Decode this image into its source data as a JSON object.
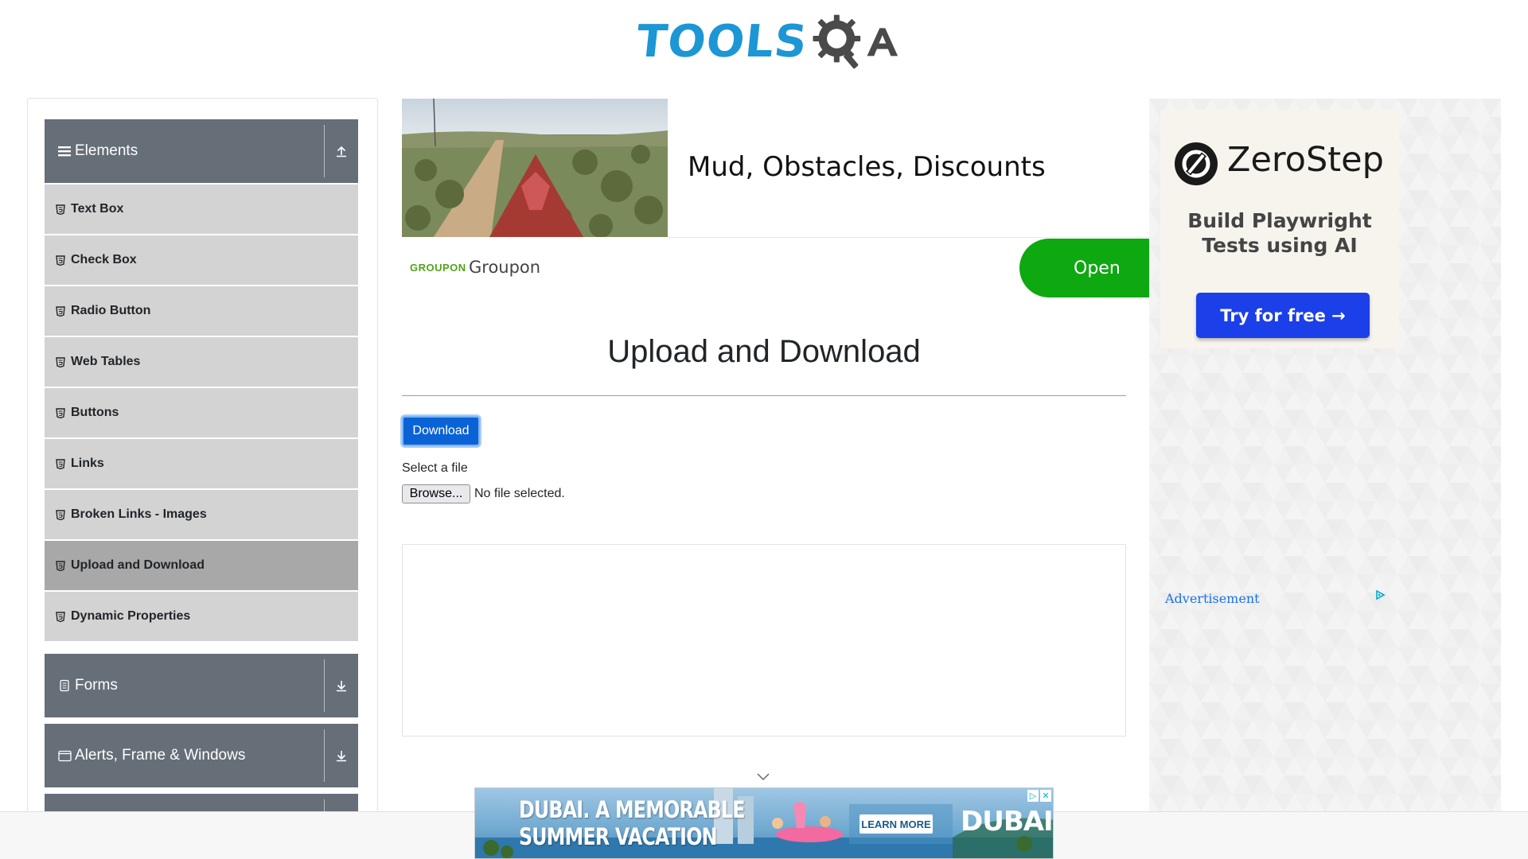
{
  "logo": {
    "text": "TOOLS",
    "suffix": "QA"
  },
  "sidebar": {
    "groups": [
      {
        "label": "Elements",
        "icon": "list-icon",
        "arrow": "collapse-up-icon"
      },
      {
        "label": "Forms",
        "icon": "doc-icon",
        "arrow": "expand-down-icon"
      },
      {
        "label": "Alerts, Frame & Windows",
        "icon": "window-icon",
        "arrow": "expand-down-icon"
      }
    ],
    "items": [
      {
        "label": "Text Box"
      },
      {
        "label": "Check Box"
      },
      {
        "label": "Radio Button"
      },
      {
        "label": "Web Tables"
      },
      {
        "label": "Buttons"
      },
      {
        "label": "Links"
      },
      {
        "label": "Broken Links - Images"
      },
      {
        "label": "Upload and Download",
        "active": true
      },
      {
        "label": "Dynamic Properties"
      }
    ]
  },
  "ad_top": {
    "headline": "Mud, Obstacles, Discounts",
    "brand_mark": "GROUPON",
    "brand": "Groupon",
    "cta": "Open"
  },
  "main": {
    "title": "Upload and Download",
    "download_label": "Download",
    "select_label": "Select a file",
    "browse_label": "Browse...",
    "file_status": "No file selected."
  },
  "ad_right": {
    "brand": "ZeroStep",
    "tagline_1": "Build Playwright",
    "tagline_2": "Tests using AI",
    "cta": "Try for free →",
    "advertisement": "Advertisement"
  },
  "banner": {
    "line1": "DUBAI. A MEMORABLE",
    "line2": "SUMMER VACATION",
    "cta": "LEARN MORE",
    "brand": "DUBAI"
  },
  "colors": {
    "group_header": "#666e78",
    "item_bg": "#d3d3d3",
    "item_active": "#a8a8a8",
    "primary": "#0a63d6",
    "groupon_green": "#0ea811"
  }
}
